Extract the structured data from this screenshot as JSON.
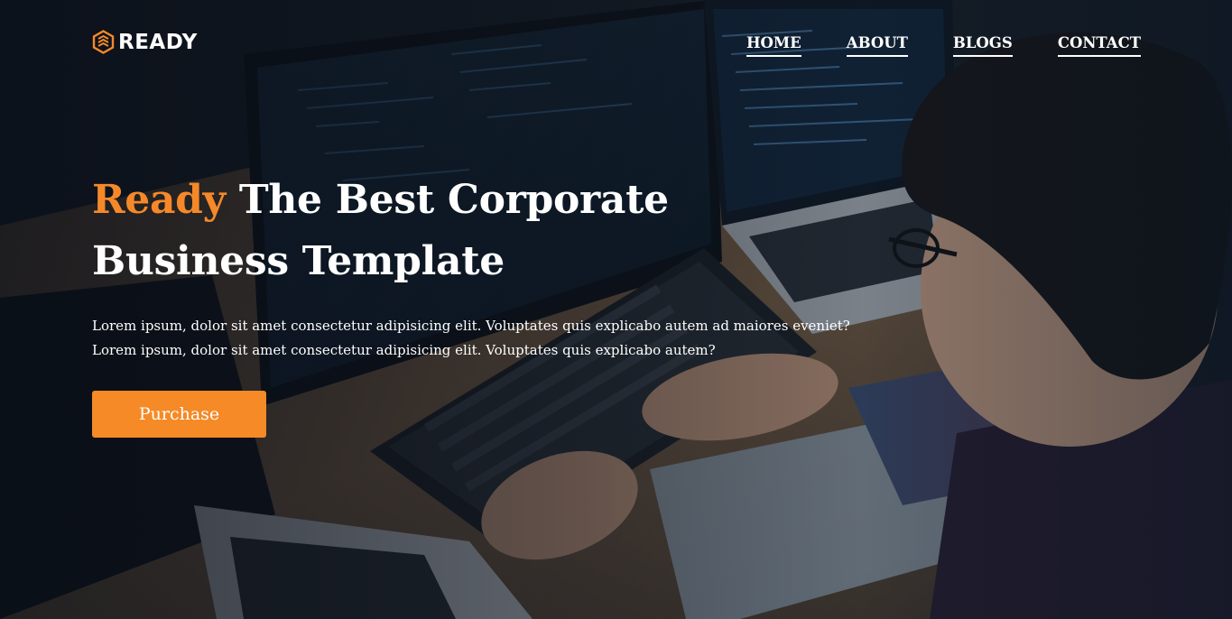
{
  "brand": {
    "name": "READY",
    "accent_color": "#f58a27",
    "icon": "hexagon-layers-icon"
  },
  "nav": {
    "items": [
      {
        "label": "HOME"
      },
      {
        "label": "ABOUT"
      },
      {
        "label": "BLOGS"
      },
      {
        "label": "CONTACT"
      }
    ]
  },
  "hero": {
    "headline_accent": "Ready",
    "headline_rest": " The Best Corporate Business Template",
    "lead_line_1": "Lorem ipsum, dolor sit amet consectetur adipisicing elit. Voluptates quis explicabo autem ad maiores eveniet?",
    "lead_line_2": "Lorem ipsum, dolor sit amet consectetur adipisicing elit. Voluptates quis explicabo autem?",
    "cta_label": "Purchase"
  }
}
